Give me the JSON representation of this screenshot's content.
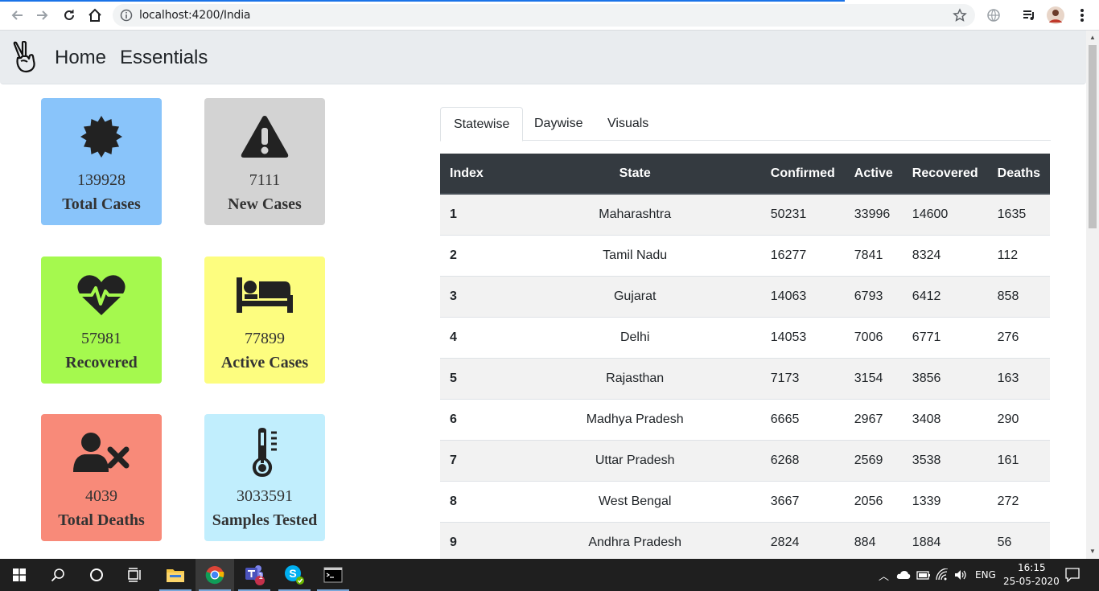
{
  "browser": {
    "url": "localhost:4200/India"
  },
  "navbar": {
    "links": [
      "Home",
      "Essentials"
    ]
  },
  "cards": [
    {
      "value": "139928",
      "label": "Total Cases",
      "color": "#89c4fa",
      "icon": "certificate-icon"
    },
    {
      "value": "7111",
      "label": "New Cases",
      "color": "#d3d3d3",
      "icon": "warning-icon"
    },
    {
      "value": "57981",
      "label": "Recovered",
      "color": "#a5f94e",
      "icon": "heartbeat-icon"
    },
    {
      "value": "77899",
      "label": "Active Cases",
      "color": "#fdfd7f",
      "icon": "bed-icon"
    },
    {
      "value": "4039",
      "label": "Total Deaths",
      "color": "#f88a79",
      "icon": "user-times-icon"
    },
    {
      "value": "3033591",
      "label": "Samples Tested",
      "color": "#c1eefd",
      "icon": "thermometer-icon"
    }
  ],
  "tabs": [
    "Statewise",
    "Daywise",
    "Visuals"
  ],
  "table": {
    "headers": [
      "Index",
      "State",
      "Confirmed",
      "Active",
      "Recovered",
      "Deaths"
    ],
    "rows": [
      [
        "1",
        "Maharashtra",
        "50231",
        "33996",
        "14600",
        "1635"
      ],
      [
        "2",
        "Tamil Nadu",
        "16277",
        "7841",
        "8324",
        "112"
      ],
      [
        "3",
        "Gujarat",
        "14063",
        "6793",
        "6412",
        "858"
      ],
      [
        "4",
        "Delhi",
        "14053",
        "7006",
        "6771",
        "276"
      ],
      [
        "5",
        "Rajasthan",
        "7173",
        "3154",
        "3856",
        "163"
      ],
      [
        "6",
        "Madhya Pradesh",
        "6665",
        "2967",
        "3408",
        "290"
      ],
      [
        "7",
        "Uttar Pradesh",
        "6268",
        "2569",
        "3538",
        "161"
      ],
      [
        "8",
        "West Bengal",
        "3667",
        "2056",
        "1339",
        "272"
      ],
      [
        "9",
        "Andhra Pradesh",
        "2824",
        "884",
        "1884",
        "56"
      ]
    ]
  },
  "taskbar": {
    "teams_badge": "1",
    "language": "ENG",
    "time": "16:15",
    "date": "25-05-2020"
  }
}
